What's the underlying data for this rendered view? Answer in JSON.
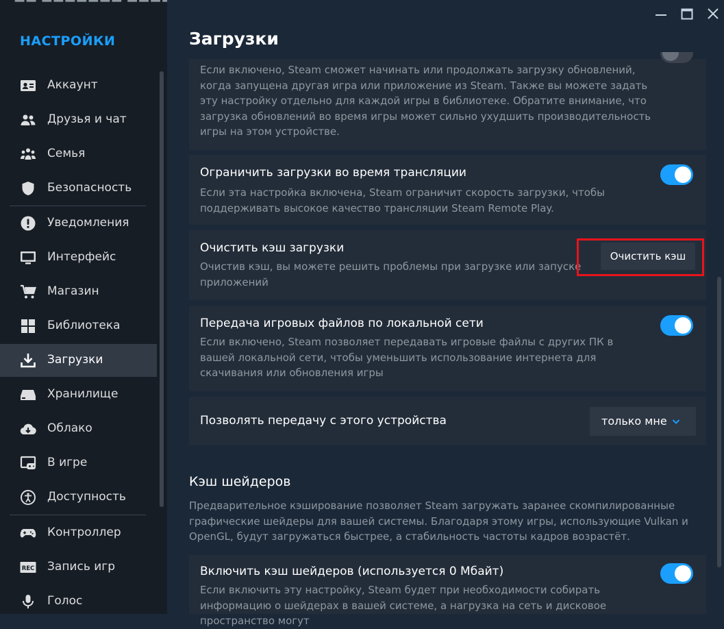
{
  "window": {
    "minimize_label": "Свернуть",
    "maximize_label": "Развернуть",
    "close_label": "Закрыть"
  },
  "sidebar": {
    "title": "НАСТРОЙКИ",
    "items": [
      {
        "label": "Аккаунт",
        "icon": "account-card-icon"
      },
      {
        "label": "Друзья и чат",
        "icon": "friends-icon"
      },
      {
        "label": "Семья",
        "icon": "family-icon"
      },
      {
        "label": "Безопасность",
        "icon": "shield-icon"
      },
      {
        "label": "Уведомления",
        "icon": "exclamation-icon"
      },
      {
        "label": "Интерфейс",
        "icon": "monitor-icon"
      },
      {
        "label": "Магазин",
        "icon": "cart-icon"
      },
      {
        "label": "Библиотека",
        "icon": "grid-icon"
      },
      {
        "label": "Загрузки",
        "icon": "download-icon",
        "active": true
      },
      {
        "label": "Хранилище",
        "icon": "storage-icon"
      },
      {
        "label": "Облако",
        "icon": "cloud-icon"
      },
      {
        "label": "В игре",
        "icon": "ingame-icon"
      },
      {
        "label": "Доступность",
        "icon": "accessibility-icon"
      },
      {
        "label": "Контроллер",
        "icon": "gamepad-icon"
      },
      {
        "label": "Запись игр",
        "icon": "rec-icon"
      },
      {
        "label": "Голос",
        "icon": "microphone-icon"
      }
    ]
  },
  "page": {
    "title": "Загрузки"
  },
  "settings": {
    "background_updates": {
      "description": "Если включено, Steam сможет начинать или продолжать загрузку обновлений, когда запущена другая игра или приложение из Steam. Также вы можете задать эту настройку отдельно для каждой игры в библиотеке. Обратите внимание, что загрузка обновлений во время игры может сильно ухудшить производительность игры на этом устройстве."
    },
    "throttle_broadcast": {
      "title": "Ограничить загрузки во время трансляции",
      "description": "Если эта настройка включена, Steam ограничит скорость загрузки, чтобы поддерживать высокое качество трансляции Steam Remote Play.",
      "enabled": true
    },
    "clear_cache": {
      "title": "Очистить кэш загрузки",
      "description": "Очистив кэш, вы можете решить проблемы при загрузке или запуске приложений",
      "button_label": "Очистить кэш"
    },
    "lan_transfer": {
      "title": "Передача игровых файлов по локальной сети",
      "description": "Если включено, Steam позволяет передавать игровые файлы с других ПК в вашей локальной сети, чтобы уменьшить использование интернета для скачивания или обновления игры",
      "enabled": true
    },
    "allow_transfer": {
      "title": "Позволять передачу с этого устройства",
      "selected": "только мне"
    }
  },
  "shader_cache": {
    "section_title": "Кэш шейдеров",
    "section_description": "Предварительное кэширование позволяет Steam загружать заранее скомпилированные графические шейдеры для вашей системы. Благодаря этому игры, использующие Vulkan и OpenGL, будут загружаться быстрее, а стабильность частоты кадров возрастёт.",
    "enable": {
      "title": "Включить кэш шейдеров (используется 0 Мбайт)",
      "description": "Если включить эту настройку, Steam будет при необходимости собирать информацию о шейдерах в вашей системе, а нагрузка на сеть и дисковое пространство могут",
      "enabled": true
    }
  },
  "colors": {
    "accent": "#1a9fff",
    "highlight": "#e8131b",
    "background": "#1b2838",
    "sidebar": "#171d25",
    "card": "#232d39"
  }
}
